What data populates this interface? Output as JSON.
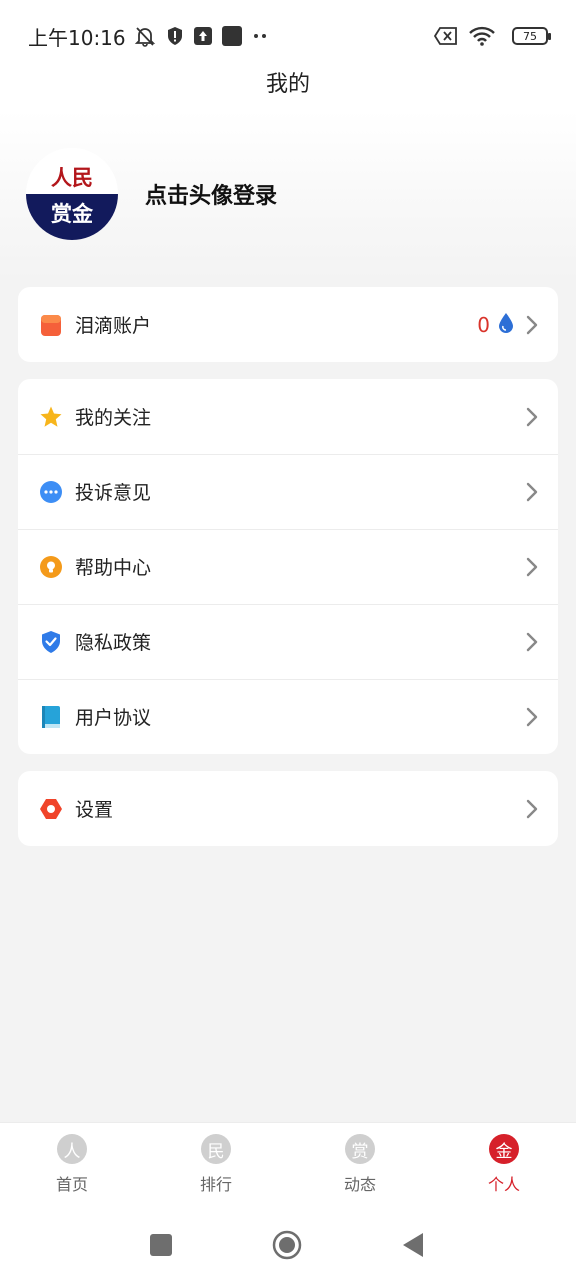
{
  "status_bar": {
    "time": "上午10:16",
    "battery": "75"
  },
  "header": {
    "title": "我的"
  },
  "profile": {
    "avatar_text_top": "人民",
    "avatar_text_bottom": "赏金",
    "login_prompt": "点击头像登录"
  },
  "account": {
    "label": "泪滴账户",
    "tear_count": "0"
  },
  "menu": {
    "follow": "我的关注",
    "complaint": "投诉意见",
    "help": "帮助中心",
    "privacy": "隐私政策",
    "agreement": "用户协议"
  },
  "settings": {
    "label": "设置"
  },
  "tabs": [
    {
      "glyph": "人",
      "label": "首页"
    },
    {
      "glyph": "民",
      "label": "排行"
    },
    {
      "glyph": "赏",
      "label": "动态"
    },
    {
      "glyph": "金",
      "label": "个人"
    }
  ],
  "colors": {
    "accent": "#d6202a",
    "background": "#f3f3f3",
    "card": "#ffffff"
  }
}
